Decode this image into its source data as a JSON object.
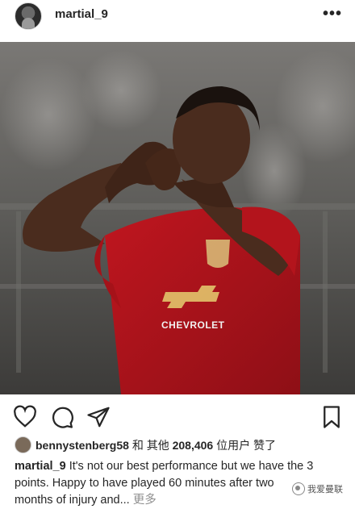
{
  "post": {
    "username": "martial_9",
    "more_label": "•••"
  },
  "photo": {
    "jersey_sponsor": "CHEVROLET",
    "colors": {
      "kit_red": "#b3141c",
      "skin": "#4a2c1e",
      "background": "#5a5957"
    }
  },
  "actions": {
    "icons": [
      "heart-icon",
      "comment-icon",
      "share-icon",
      "bookmark-icon"
    ]
  },
  "likes": {
    "liker": "bennystenberg58",
    "and_others": "和 其他",
    "count": "208,406",
    "unit": "位用户",
    "liked": "赞了"
  },
  "caption": {
    "username": "martial_9",
    "text_line1": "It's not our best performance but we have the 3",
    "text_line2": "points. Happy to have played 60 minutes after two",
    "text_line3": "months of injury and...",
    "more": "更多"
  },
  "watermark": {
    "text": "我爱曼联"
  }
}
